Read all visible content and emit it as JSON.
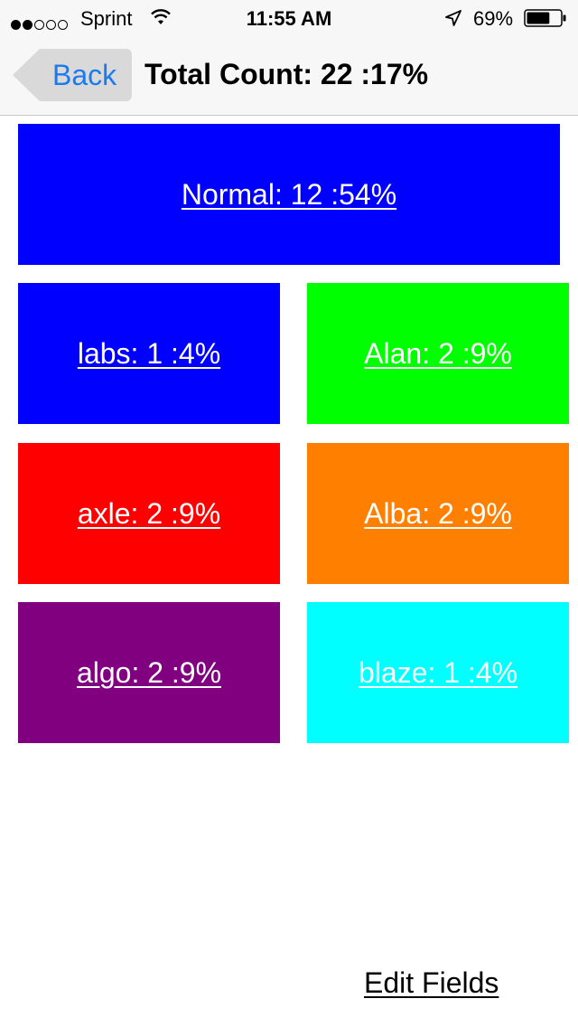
{
  "status_bar": {
    "carrier": "Sprint",
    "time": "11:55 AM",
    "battery_percent": "69%",
    "signal_strength_filled": 2,
    "signal_strength_total": 5,
    "battery_level": 0.69,
    "icons": [
      "signal-dots",
      "wifi-icon",
      "location-arrow-icon",
      "battery-icon"
    ]
  },
  "nav": {
    "back_label": "Back",
    "title": "Total Count: 22 :17%"
  },
  "tiles": [
    {
      "label": "Normal: 12 :54%",
      "color": "#0000ff"
    },
    {
      "label": "labs: 1 :4%",
      "color": "#0000ff"
    },
    {
      "label": "Alan: 2 :9%",
      "color": "#00ff00"
    },
    {
      "label": "axle: 2 :9%",
      "color": "#ff0000"
    },
    {
      "label": "Alba: 2 :9%",
      "color": "#ff8000"
    },
    {
      "label": "algo: 2 :9%",
      "color": "#800080"
    },
    {
      "label": "blaze: 1 :4%",
      "color": "#00ffff"
    }
  ],
  "footer": {
    "edit_fields_label": "Edit Fields"
  }
}
